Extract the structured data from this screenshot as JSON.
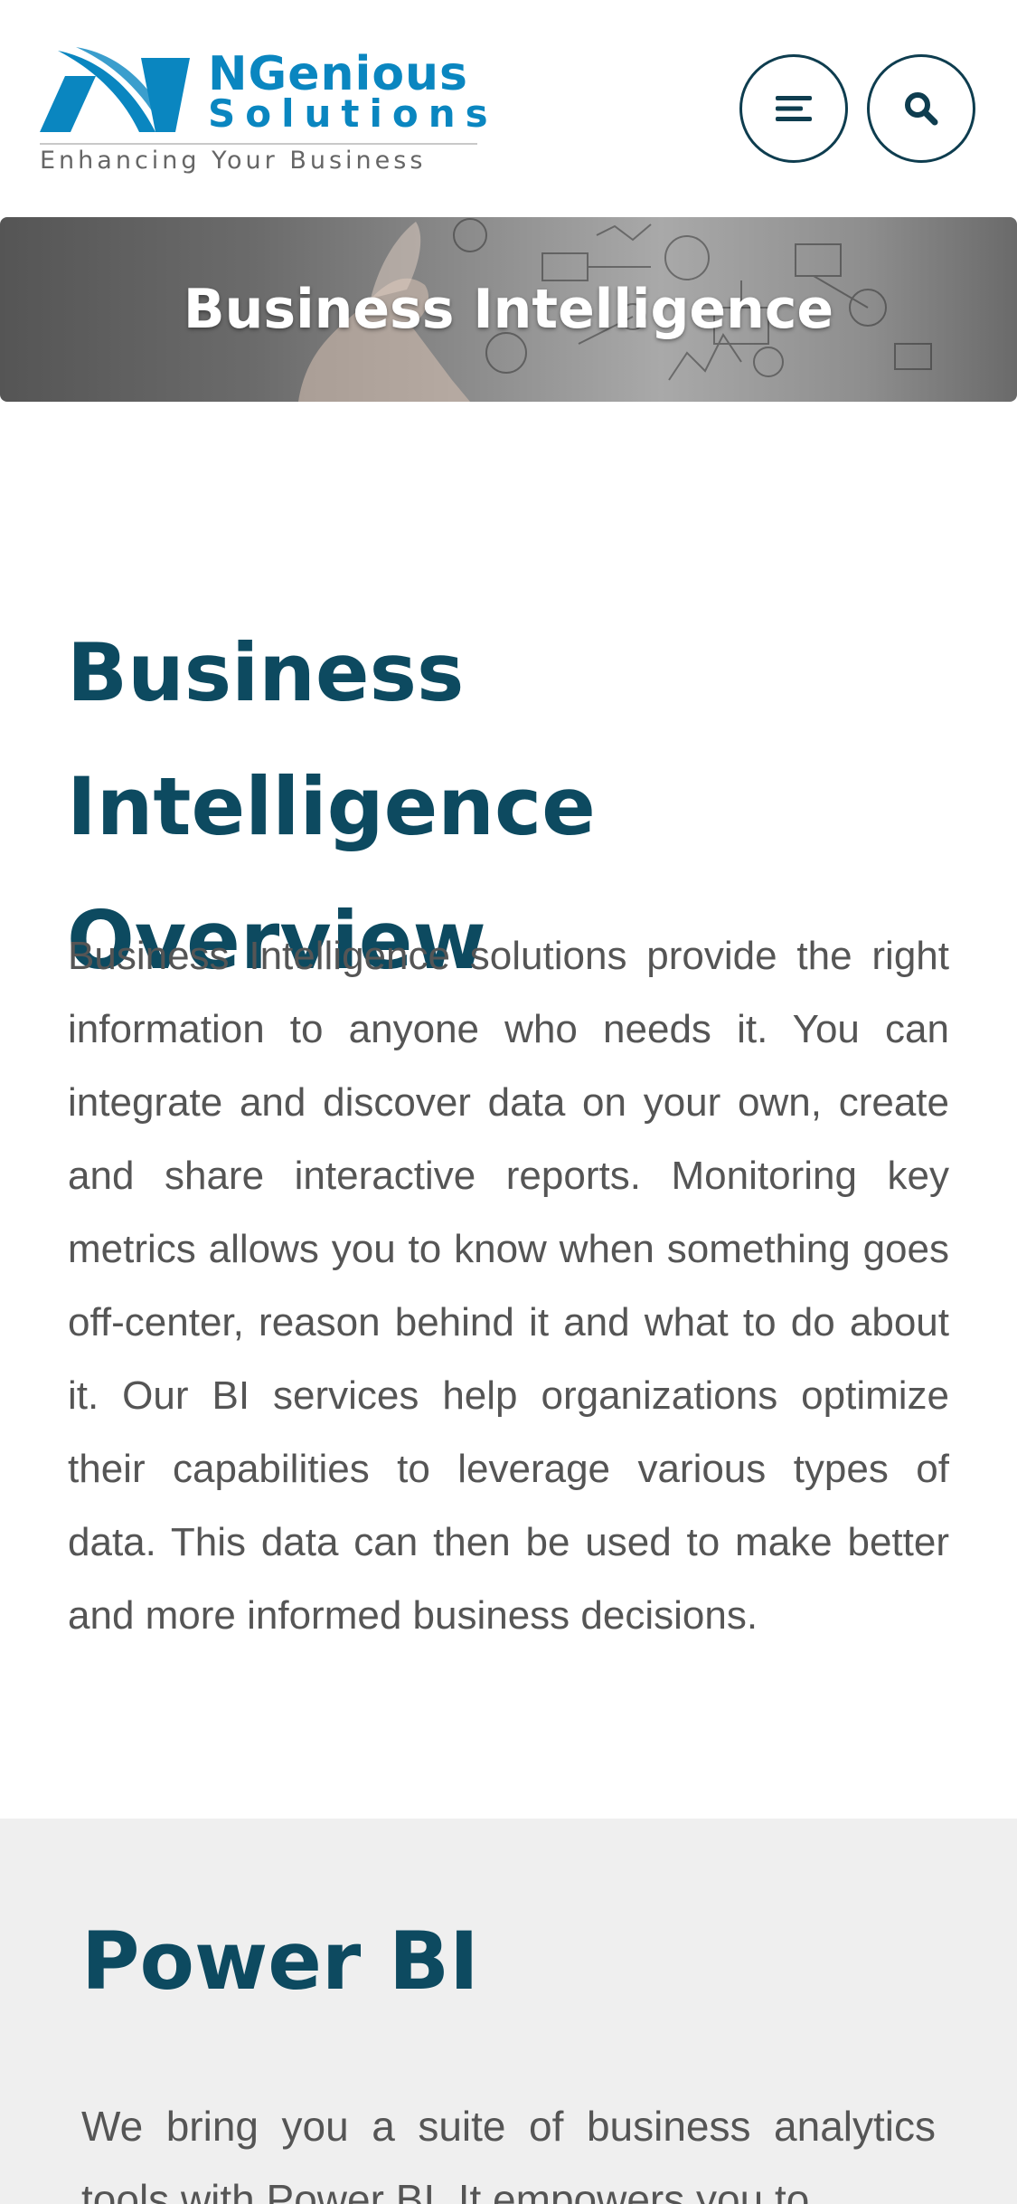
{
  "header": {
    "logo": {
      "name": "NGenious",
      "sub": "Solutions",
      "tagline": "Enhancing Your Business"
    },
    "menu_icon": "menu-icon",
    "search_icon": "search-icon",
    "accent_color": "#0a86c0",
    "border_color": "#0e3d4f"
  },
  "hero": {
    "title": "Business Intelligence"
  },
  "overview": {
    "title": "Business Intelligence Overview",
    "body": "Business Intelligence solutions provide the right information to anyone who needs it. You can integrate and discover data on your own, create and share interactive reports. Monitoring key metrics allows you to know when something goes off-center, reason behind it and what to do about it. Our BI services help organizations optimize their capabilities to leverage various types of data. This data can then be used to make better and more informed business decisions."
  },
  "powerbi": {
    "title": "Power BI",
    "body": "We bring you a suite of business analytics tools with Power BI. It empowers you to"
  },
  "colors": {
    "heading": "#0d4a60",
    "section_bg": "#efefef"
  }
}
